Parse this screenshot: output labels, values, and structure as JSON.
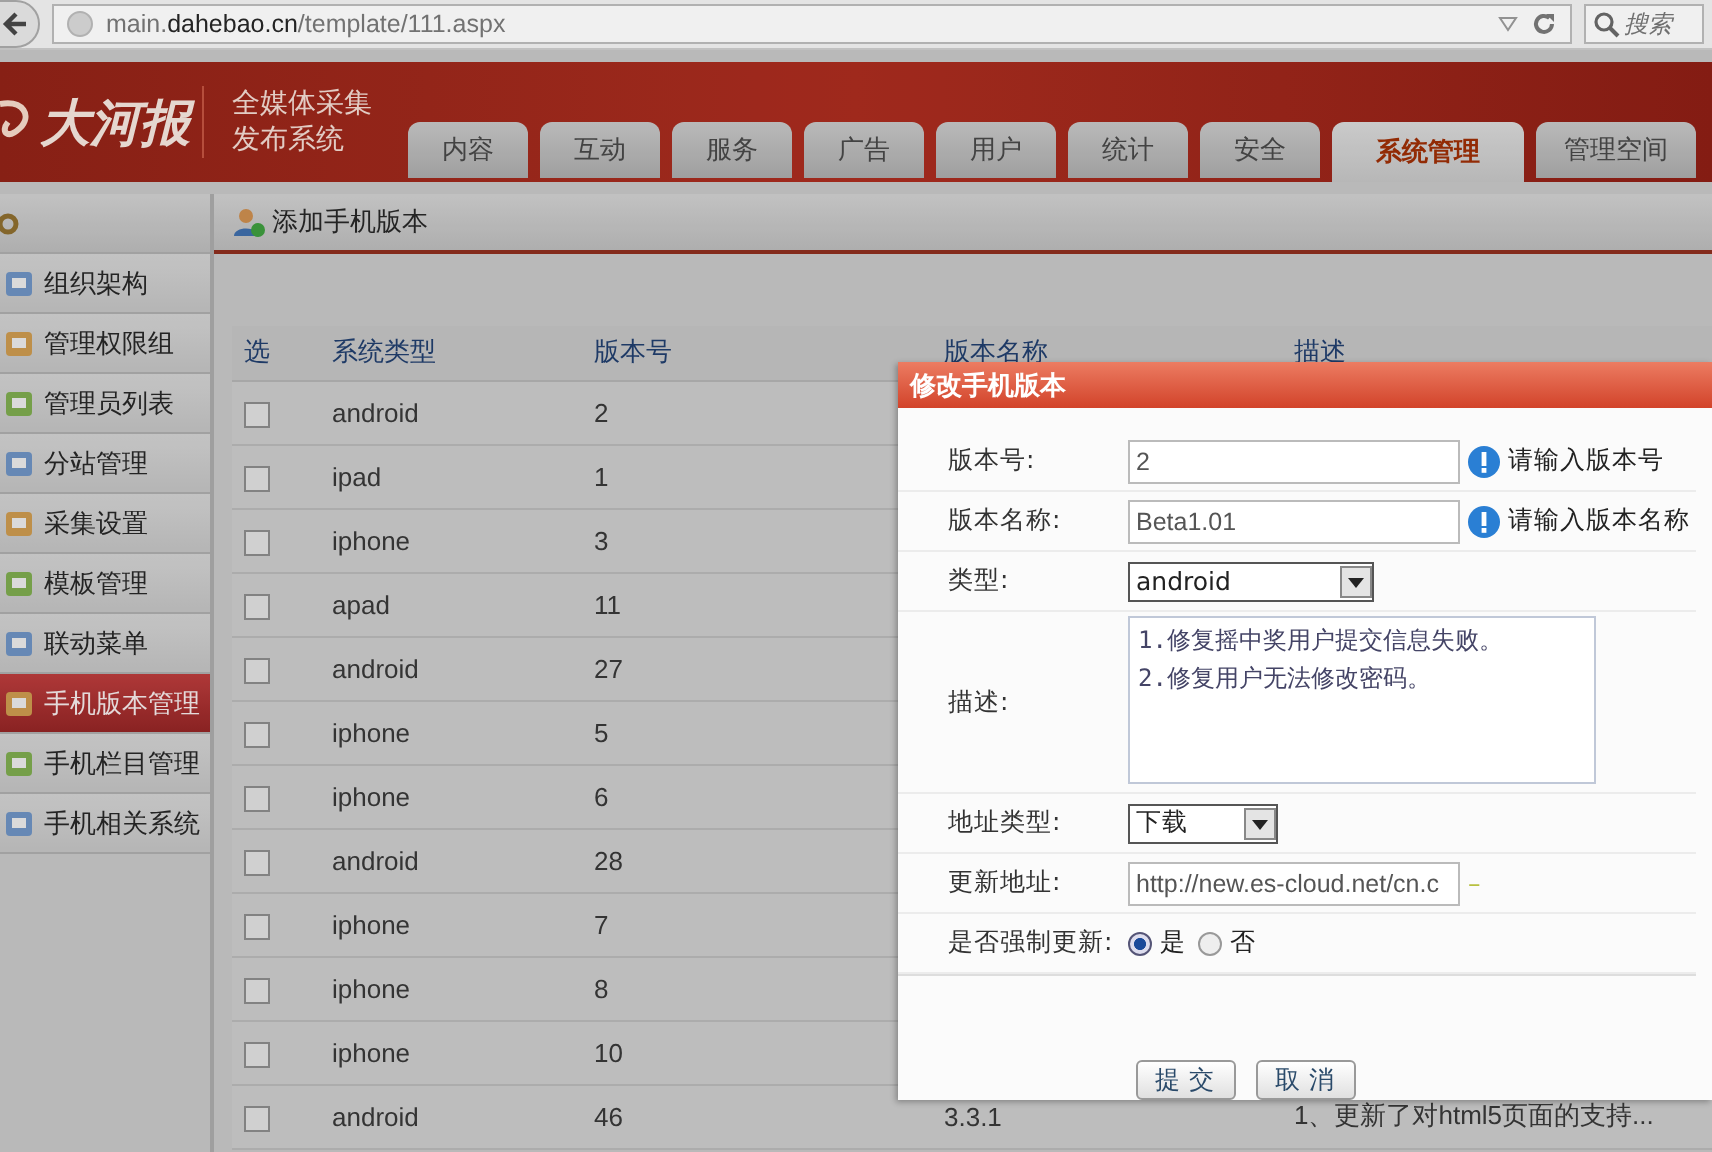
{
  "browser": {
    "url_prefix": "main.",
    "url_domain": "dahebao.cn",
    "url_path": "/template/111.aspx",
    "search_placeholder": "搜索"
  },
  "header": {
    "logo": "大河报",
    "subtitle_lines": [
      "全媒体采集",
      "发布系统"
    ]
  },
  "tabs": [
    {
      "label": "内容",
      "selected": false
    },
    {
      "label": "互动",
      "selected": false
    },
    {
      "label": "服务",
      "selected": false
    },
    {
      "label": "广告",
      "selected": false
    },
    {
      "label": "用户",
      "selected": false
    },
    {
      "label": "统计",
      "selected": false
    },
    {
      "label": "安全",
      "selected": false
    },
    {
      "label": "系统管理",
      "selected": true
    },
    {
      "label": "管理空间",
      "selected": false
    }
  ],
  "toolbar": {
    "add_button": "添加手机版本"
  },
  "sidebar": {
    "items": [
      {
        "label": "组织架构",
        "selected": false
      },
      {
        "label": "管理权限组",
        "selected": false
      },
      {
        "label": "管理员列表",
        "selected": false
      },
      {
        "label": "分站管理",
        "selected": false
      },
      {
        "label": "采集设置",
        "selected": false
      },
      {
        "label": "模板管理",
        "selected": false
      },
      {
        "label": "联动菜单",
        "selected": false
      },
      {
        "label": "手机版本管理",
        "selected": true
      },
      {
        "label": "手机栏目管理",
        "selected": false
      },
      {
        "label": "手机相关系统",
        "selected": false
      }
    ]
  },
  "table": {
    "columns": [
      "选",
      "系统类型",
      "版本号",
      "版本名称",
      "描述"
    ],
    "rows": [
      {
        "checked": false,
        "system": "android",
        "version": "2"
      },
      {
        "checked": false,
        "system": "ipad",
        "version": "1"
      },
      {
        "checked": false,
        "system": "iphone",
        "version": "3"
      },
      {
        "checked": false,
        "system": "apad",
        "version": "11"
      },
      {
        "checked": false,
        "system": "android",
        "version": "27"
      },
      {
        "checked": false,
        "system": "iphone",
        "version": "5"
      },
      {
        "checked": false,
        "system": "iphone",
        "version": "6"
      },
      {
        "checked": false,
        "system": "android",
        "version": "28"
      },
      {
        "checked": false,
        "system": "iphone",
        "version": "7"
      },
      {
        "checked": false,
        "system": "iphone",
        "version": "8"
      },
      {
        "checked": false,
        "system": "iphone",
        "version": "10"
      },
      {
        "checked": false,
        "system": "android",
        "version": "46",
        "version_name": "3.3.1",
        "description": "1、更新了对html5页面的支持..."
      }
    ]
  },
  "dialog": {
    "title": "修改手机版本",
    "fields": [
      {
        "kind": "text",
        "label": "版本号:",
        "value": "2",
        "hint": "请输入版本号",
        "hint_icon": true
      },
      {
        "kind": "text",
        "label": "版本名称:",
        "value": "Beta1.01",
        "hint": "请输入版本名称",
        "hint_icon": true
      },
      {
        "kind": "select",
        "label": "类型:",
        "value": "android"
      },
      {
        "kind": "textarea",
        "label": "描述:",
        "lines": [
          "1.修复摇中奖用户提交信息失败。",
          "2.修复用户无法修改密码。"
        ]
      },
      {
        "kind": "select",
        "label": "地址类型:",
        "value": "下载"
      },
      {
        "kind": "text",
        "label": "更新地址:",
        "value": "http://new.es-cloud.net/cn.c",
        "hint": "–",
        "hint_icon": false
      },
      {
        "kind": "radio",
        "label": "是否强制更新:",
        "options": [
          {
            "label": "是",
            "selected": true
          },
          {
            "label": "否",
            "selected": false
          }
        ]
      }
    ],
    "buttons": [
      "提 交",
      "取 消"
    ]
  }
}
